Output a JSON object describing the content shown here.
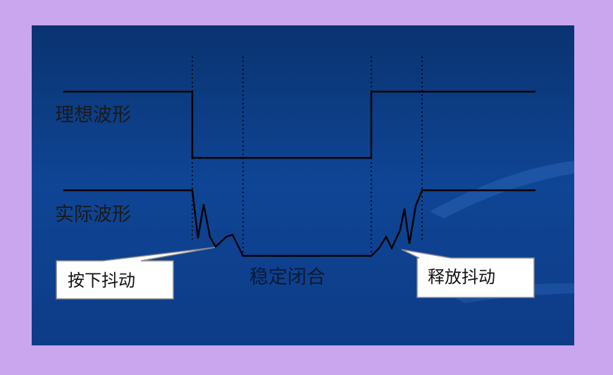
{
  "diagram": {
    "ideal_waveform_label": "理想波形",
    "actual_waveform_label": "实际波形",
    "stable_closed_label": "稳定闭合",
    "press_bounce_label": "按下抖动",
    "release_bounce_label": "释放抖动"
  },
  "colors": {
    "page_background": "#c9a6ee",
    "slide_background": "#0e3f8c",
    "waveform": "#000000",
    "callout_fill": "#ffffff"
  }
}
